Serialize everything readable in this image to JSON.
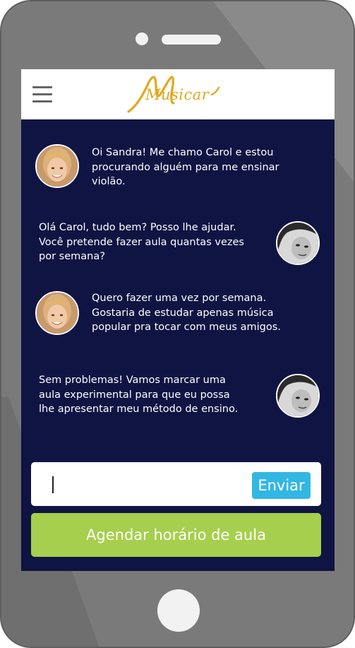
{
  "app": {
    "logo_text": "Musicar",
    "brand_color": "#e0a81f",
    "screen_bg": "#0f1443"
  },
  "header": {
    "menu_icon": "hamburger-menu-icon"
  },
  "chat": {
    "messages": [
      {
        "sender": "Carol",
        "side": "left",
        "avatar": "carol-avatar",
        "text_lines": [
          "Oi Sandra! Me chamo Carol e estou",
          "procurando alguém para me ensinar",
          "violão."
        ]
      },
      {
        "sender": "Sandra",
        "side": "right",
        "avatar": "sandra-avatar",
        "text_lines": [
          "Olá Carol, tudo bem? Posso lhe ajudar.",
          "Você pretende fazer aula quantas vezes",
          "por semana?"
        ]
      },
      {
        "sender": "Carol",
        "side": "left",
        "avatar": "carol-avatar",
        "text_lines": [
          "Quero fazer uma vez por semana.",
          "Gostaria de estudar apenas música",
          "popular pra tocar com meus amigos."
        ]
      },
      {
        "sender": "Sandra",
        "side": "right",
        "avatar": "sandra-avatar",
        "text_lines": [
          "Sem problemas! Vamos marcar uma",
          "aula experimental para que eu possa",
          "lhe apresentar meu método de ensino."
        ]
      }
    ]
  },
  "composer": {
    "input_value": "",
    "send_label": "Enviar",
    "send_color": "#32b7e3"
  },
  "actions": {
    "schedule_label": "Agendar horário de aula",
    "schedule_color": "#a6cf4d"
  }
}
